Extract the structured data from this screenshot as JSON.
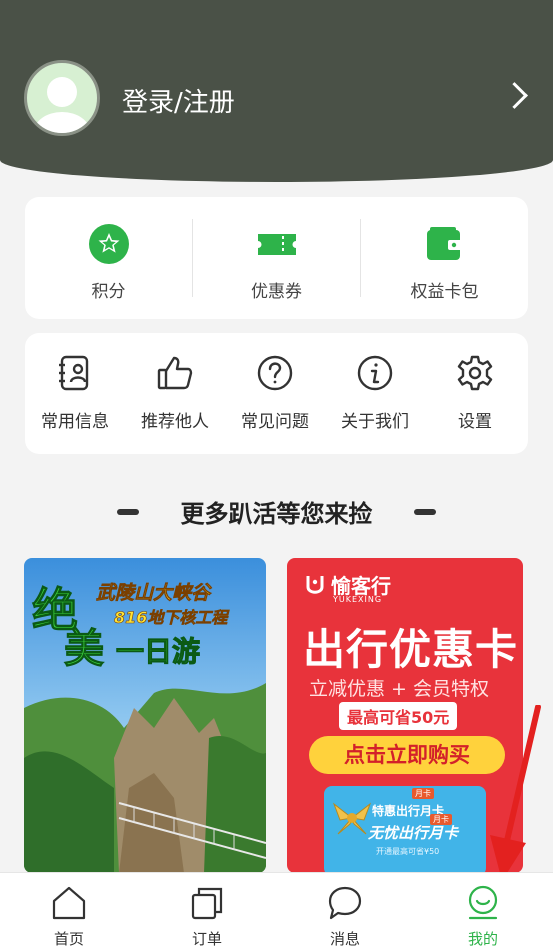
{
  "header": {
    "login_label": "登录/注册"
  },
  "quick": [
    {
      "label": "积分",
      "icon": "star-badge-icon"
    },
    {
      "label": "优惠券",
      "icon": "ticket-icon"
    },
    {
      "label": "权益卡包",
      "icon": "wallet-icon"
    }
  ],
  "services": [
    {
      "label": "常用信息",
      "icon": "contact-card-icon"
    },
    {
      "label": "推荐他人",
      "icon": "thumbs-up-icon"
    },
    {
      "label": "常见问题",
      "icon": "question-icon"
    },
    {
      "label": "关于我们",
      "icon": "info-icon"
    },
    {
      "label": "设置",
      "icon": "gear-icon"
    }
  ],
  "section": {
    "title": "更多趴活等您来捡"
  },
  "promos": [
    {
      "line1": "绝",
      "line2": "美",
      "line3": "一日游",
      "tag1": "武陵山大峡谷",
      "tag2": "816地下核工程"
    },
    {
      "brand_cn": "愉客行",
      "brand_en": "YUKEXING",
      "headline": "出行优惠卡",
      "sub": "立减优惠 + 会员特权",
      "save": "最高可省50元",
      "cta": "点击立即购买",
      "card_title": "无忧出行月卡",
      "card_sub": "开通最高可省¥50",
      "card_tag": "特惠出行月卡",
      "card_badge1": "月卡",
      "card_badge2": "月卡"
    }
  ],
  "nav": [
    {
      "label": "首页",
      "icon": "home-icon",
      "active": false
    },
    {
      "label": "订单",
      "icon": "orders-icon",
      "active": false
    },
    {
      "label": "消息",
      "icon": "chat-icon",
      "active": false
    },
    {
      "label": "我的",
      "icon": "profile-icon",
      "active": true
    }
  ],
  "colors": {
    "header_bg": "#4a5147",
    "accent_green": "#2eb34a",
    "promo_red": "#e8333b",
    "arrow_red": "#e3211f"
  }
}
